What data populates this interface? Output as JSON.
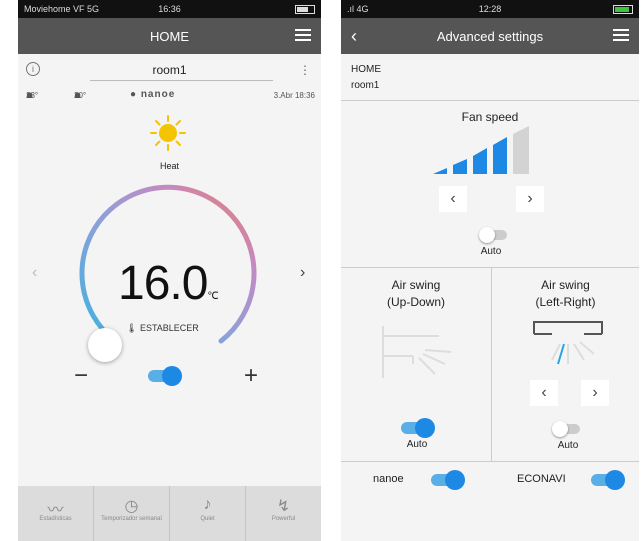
{
  "phone1": {
    "status": {
      "carrier": "Moviehome VF 5G",
      "time": "16:36"
    },
    "title": "HOME",
    "room": "room1",
    "info": {
      "indoor_temp": "23°",
      "outdoor_temp": "20°",
      "brand": "nanoe",
      "date": "3.Abr 18:36"
    },
    "mode": "Heat",
    "temperature": {
      "value": "16.0",
      "unit": "℃"
    },
    "set_label": "ESTABLECER",
    "power_on": true,
    "bottom_nav": [
      {
        "label": "Estadísticas",
        "icon": "chart-icon"
      },
      {
        "label": "Temporizador semanal",
        "icon": "timer-icon"
      },
      {
        "label": "Quiet",
        "icon": "quiet-icon"
      },
      {
        "label": "Powerful",
        "icon": "powerful-icon"
      }
    ]
  },
  "phone2": {
    "status": {
      "signal": "4G",
      "time": "12:28"
    },
    "title": "Advanced settings",
    "home": "HOME",
    "room": "room1",
    "fan_speed": {
      "label": "Fan speed",
      "level": 4,
      "max": 5,
      "auto_label": "Auto",
      "auto": false
    },
    "swing_updown": {
      "title_line1": "Air swing",
      "title_line2": "(Up-Down)",
      "auto_label": "Auto",
      "auto": true
    },
    "swing_leftright": {
      "title_line1": "Air swing",
      "title_line2": "(Left-Right)",
      "auto_label": "Auto",
      "auto": false
    },
    "nanoe": {
      "label": "nanoe",
      "on": true
    },
    "econavi": {
      "label": "ECONAVI",
      "on": true
    }
  },
  "colors": {
    "accent": "#1e88e5",
    "titlebar": "#555555",
    "sun": "#f5c400"
  }
}
